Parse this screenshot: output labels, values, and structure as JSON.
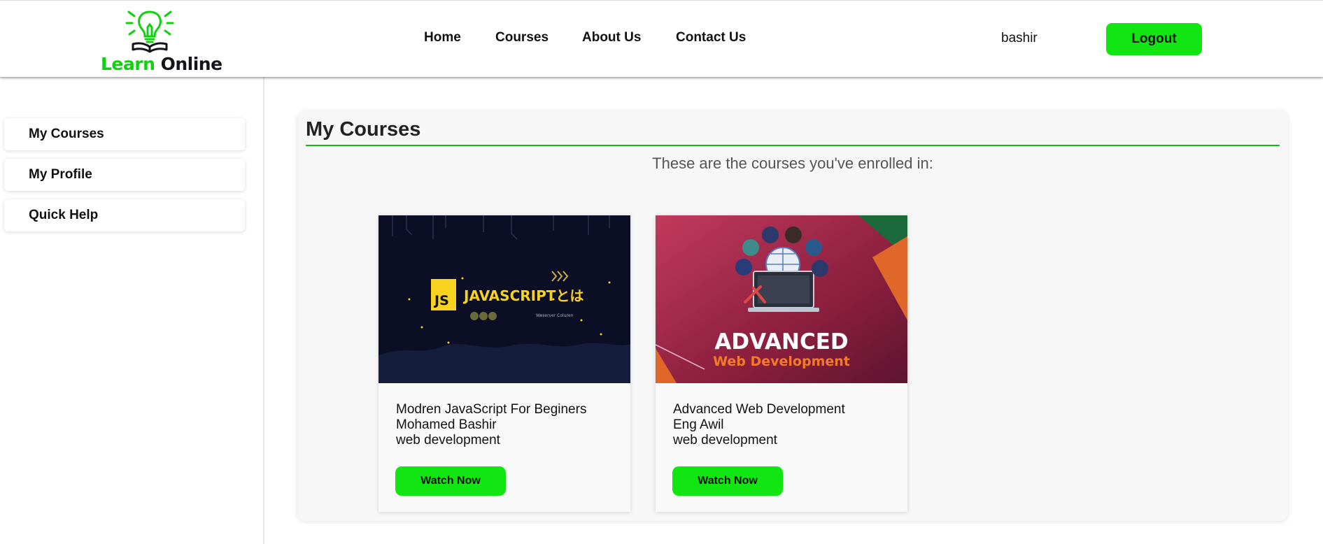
{
  "header": {
    "logo": {
      "icon": "lightbulb-book-icon",
      "learn": "Learn",
      "online": "Online"
    },
    "nav": [
      "Home",
      "Courses",
      "About Us",
      "Contact Us"
    ],
    "username": "bashir",
    "logout_label": "Logout"
  },
  "sidebar": {
    "items": [
      {
        "label": "My Courses"
      },
      {
        "label": "My Profile"
      },
      {
        "label": "Quick Help"
      }
    ]
  },
  "main": {
    "title": "My Courses",
    "subtitle": "These are the courses you've enrolled in:",
    "courses": [
      {
        "title": "Modren JavaScript For Beginers",
        "instructor": "Mohamed Bashir",
        "category": "web development",
        "button_label": "Watch Now",
        "thumbnail": {
          "badge": "JS",
          "text": "JAVASCRIPTとは",
          "small": "Weserver Coluren"
        }
      },
      {
        "title": "Advanced Web Development",
        "instructor": "Eng Awil",
        "category": "web development",
        "button_label": "Watch Now",
        "thumbnail": {
          "line1": "ADVANCED",
          "line2": "Web Development"
        }
      }
    ]
  },
  "colors": {
    "accent": "#12e612",
    "logo_green": "#10d010",
    "rule": "#1cb21c"
  }
}
